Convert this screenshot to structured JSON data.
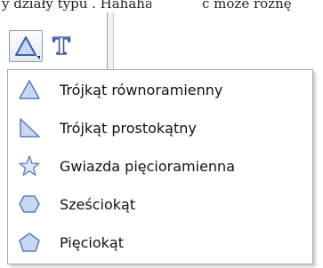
{
  "background_snippet": {
    "left_text": "y działy typu . Hahahahalarte",
    "right_text": "ć może różnę"
  },
  "toolbar": {
    "shape_tool": {
      "icon": "triangle-icon",
      "selected": true
    },
    "text_tool": {
      "icon": "text-t-icon",
      "label": "T"
    }
  },
  "shape_menu": {
    "items": [
      {
        "label": "Trójkąt równoramienny",
        "icon": "isosceles-triangle-icon"
      },
      {
        "label": "Trójkąt prostokątny",
        "icon": "right-triangle-icon"
      },
      {
        "label": "Gwiazda pięcioramienna",
        "icon": "five-point-star-icon"
      },
      {
        "label": "Sześciokąt",
        "icon": "hexagon-icon"
      },
      {
        "label": "Pięciokąt",
        "icon": "pentagon-icon"
      }
    ]
  },
  "colors": {
    "icon_fill": "#c9d7f2",
    "icon_stroke": "#5a7bb8",
    "text_icon": "#3a57a8"
  }
}
